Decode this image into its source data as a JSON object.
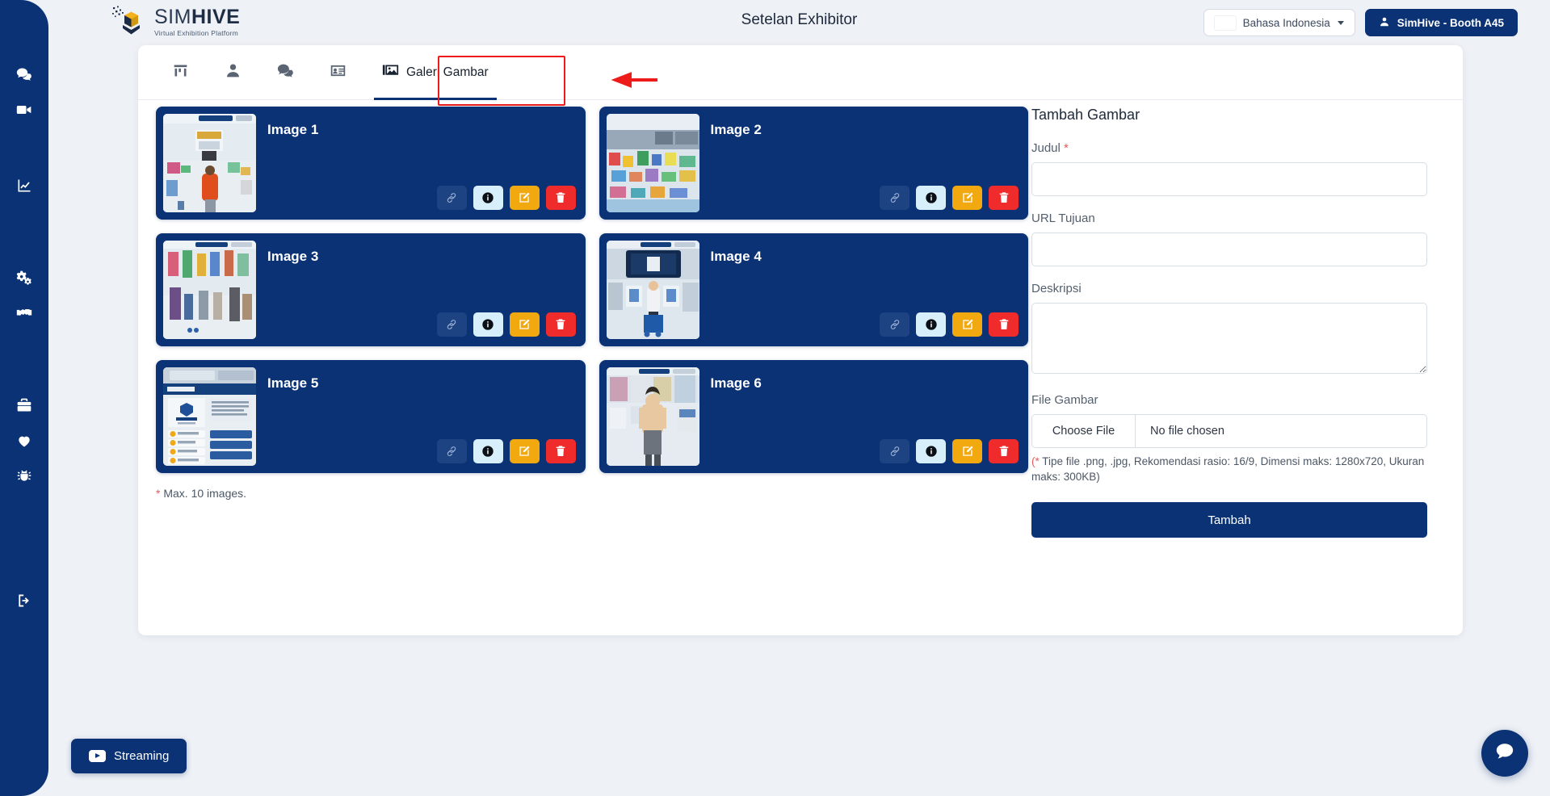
{
  "header": {
    "logo_primary": "SIM",
    "logo_primary_bold": "HIVE",
    "logo_tagline": "Virtual Exhibition Platform",
    "page_title": "Setelan Exhibitor",
    "language_label": "Bahasa Indonesia",
    "user_label": "SimHive - Booth A45"
  },
  "sidebar": {
    "items": [
      {
        "name": "chat",
        "icon": "chat-icon"
      },
      {
        "name": "video",
        "icon": "video-camera-icon"
      },
      {
        "name": "analytics",
        "icon": "chart-line-icon"
      },
      {
        "name": "settings",
        "icon": "gears-icon"
      },
      {
        "name": "handshake",
        "icon": "handshake-icon"
      },
      {
        "name": "briefcase",
        "icon": "briefcase-icon"
      },
      {
        "name": "favorites",
        "icon": "heart-icon"
      },
      {
        "name": "report-bug",
        "icon": "bug-icon"
      },
      {
        "name": "logout",
        "icon": "logout-icon"
      }
    ]
  },
  "tabs": [
    {
      "label": "",
      "icon": "booth-icon",
      "active": false
    },
    {
      "label": "",
      "icon": "person-icon",
      "active": false
    },
    {
      "label": "",
      "icon": "chat-icon",
      "active": false
    },
    {
      "label": "",
      "icon": "id-card-icon",
      "active": false
    },
    {
      "label": "Galeri Gambar",
      "icon": "image-icon",
      "active": true
    }
  ],
  "gallery": {
    "items": [
      {
        "title": "Image 1",
        "scene": "hall-avatar"
      },
      {
        "title": "Image 2",
        "scene": "hall-wide"
      },
      {
        "title": "Image 3",
        "scene": "aisle-crowd"
      },
      {
        "title": "Image 4",
        "scene": "booth-stage"
      },
      {
        "title": "Image 5",
        "scene": "booth-detail-page"
      },
      {
        "title": "Image 6",
        "scene": "avatar-booth"
      }
    ],
    "actions": {
      "link": "link-icon",
      "info": "info-icon",
      "edit": "edit-icon",
      "delete": "trash-icon"
    },
    "max_note_star": "*",
    "max_note": " Max. 10 images."
  },
  "form": {
    "heading": "Tambah Gambar",
    "title_label": "Judul ",
    "title_required": "*",
    "title_value": "",
    "url_label": "URL Tujuan",
    "url_value": "",
    "description_label": "Deskripsi",
    "description_value": "",
    "file_label": "File Gambar",
    "choose_file": "Choose File",
    "no_file": "No file chosen",
    "file_help_star": "(*",
    "file_help": " Tipe file .png, .jpg, Rekomendasi rasio: 16/9, Dimensi maks: 1280x720, Ukuran maks: 300KB)",
    "submit_label": "Tambah"
  },
  "floating": {
    "streaming_label": "Streaming",
    "chat_icon": "chat-bubble-icon"
  },
  "colors": {
    "brand_navy": "#0a3274",
    "accent_orange": "#f1a90f",
    "danger_red": "#ef2b2b",
    "info_blue": "#d7eefb",
    "annotation_red": "#ee1b1b",
    "page_bg": "#eef1f6"
  }
}
